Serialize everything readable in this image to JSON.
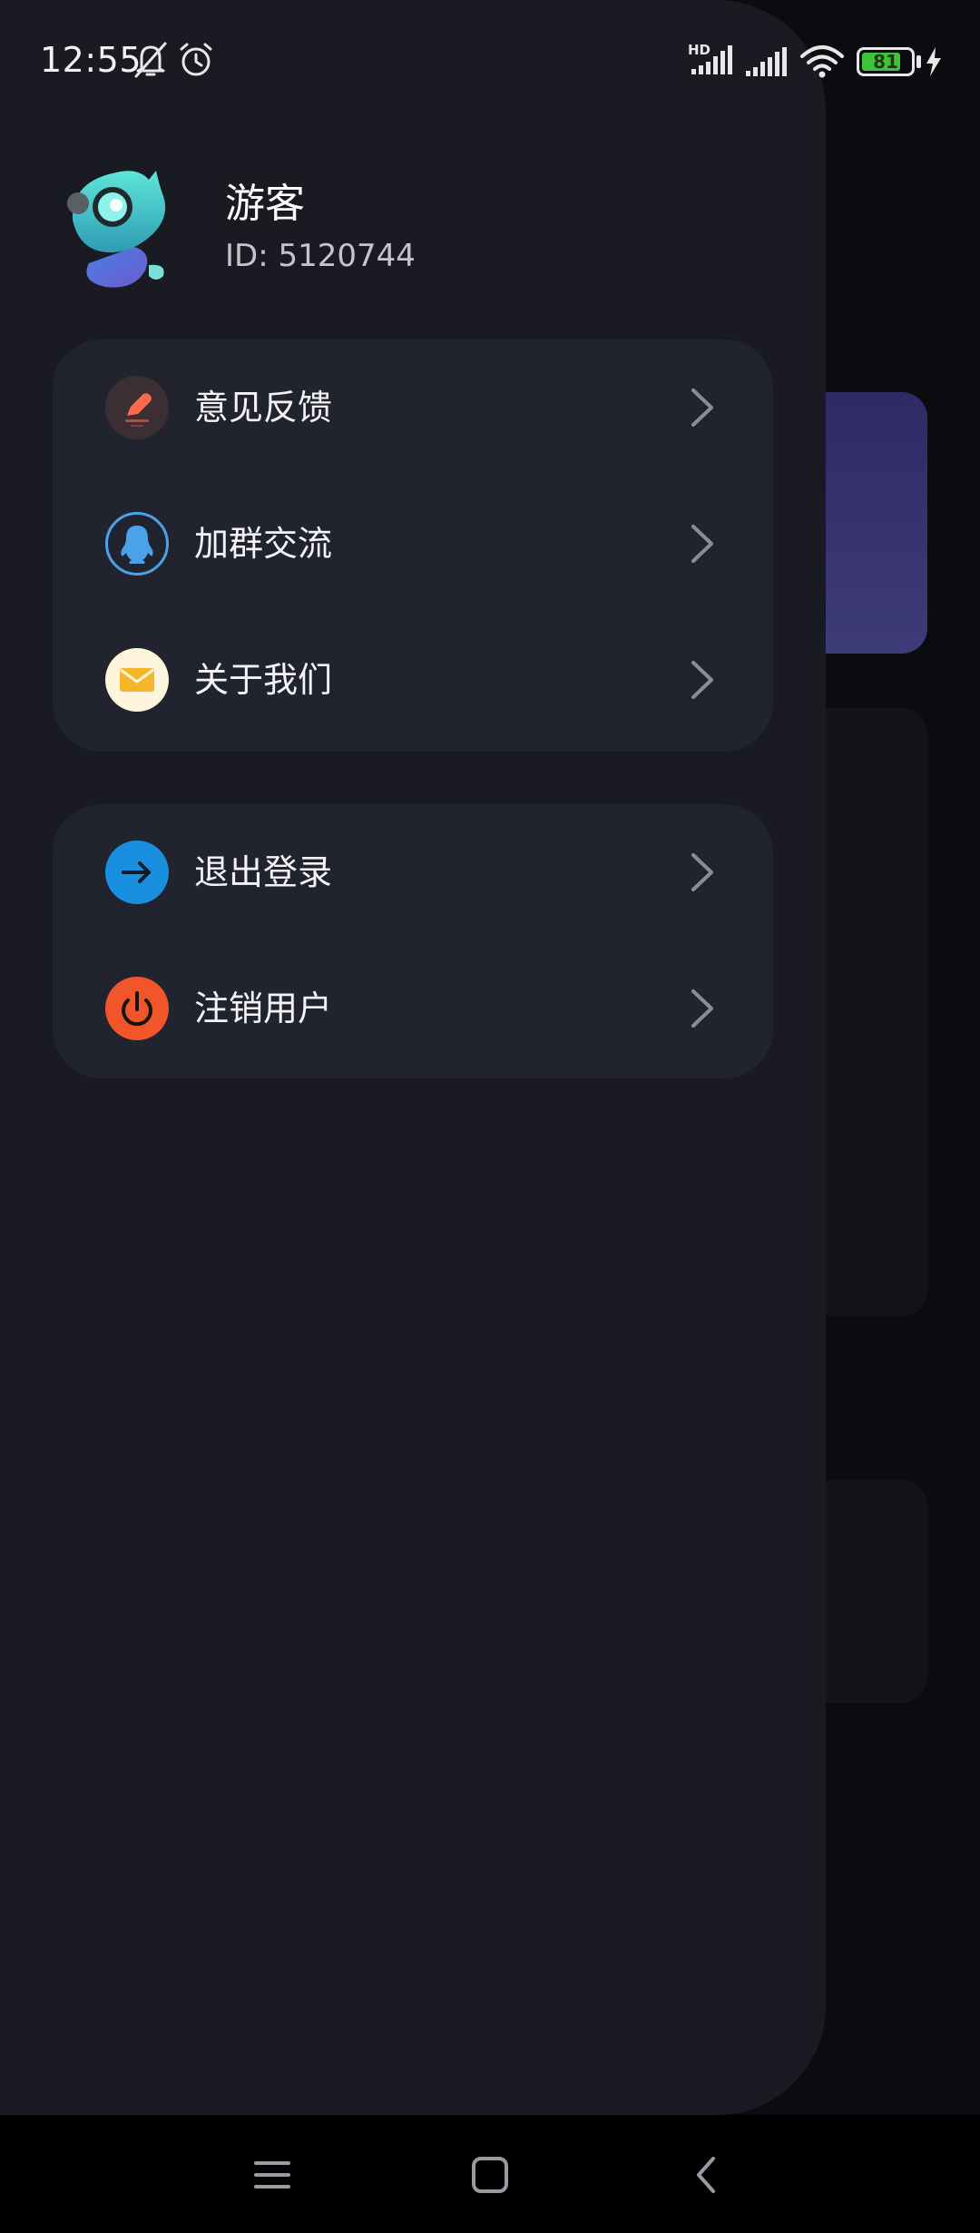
{
  "status_bar": {
    "time": "12:55",
    "network_badge": "HD",
    "battery_level": 81,
    "icons": [
      "bell-off-icon",
      "alarm-icon",
      "signal-hd-icon",
      "signal-icon",
      "wifi-icon",
      "battery-icon",
      "charging-icon"
    ]
  },
  "profile": {
    "name": "游客",
    "id_text": "ID: 5120744"
  },
  "menu_group_1": [
    {
      "label": "意见反馈",
      "icon": "feedback-pen-icon",
      "icon_color": "#ff6a4d"
    },
    {
      "label": "加群交流",
      "icon": "qq-penguin-icon",
      "icon_color": "#4aa3e8"
    },
    {
      "label": "关于我们",
      "icon": "mail-icon",
      "icon_color": "#f7b52c"
    }
  ],
  "menu_group_2": [
    {
      "label": "退出登录",
      "icon": "logout-arrow-icon",
      "icon_color": "#1a8fe0"
    },
    {
      "label": "注销用户",
      "icon": "power-icon",
      "icon_color": "#f0562a"
    }
  ],
  "colors": {
    "drawer_bg": "#191a22",
    "card_bg": "#21232f",
    "chevron": "#8a8c96"
  },
  "nav_bar": {
    "buttons": [
      "menu-icon",
      "home-square-icon",
      "back-icon"
    ]
  }
}
